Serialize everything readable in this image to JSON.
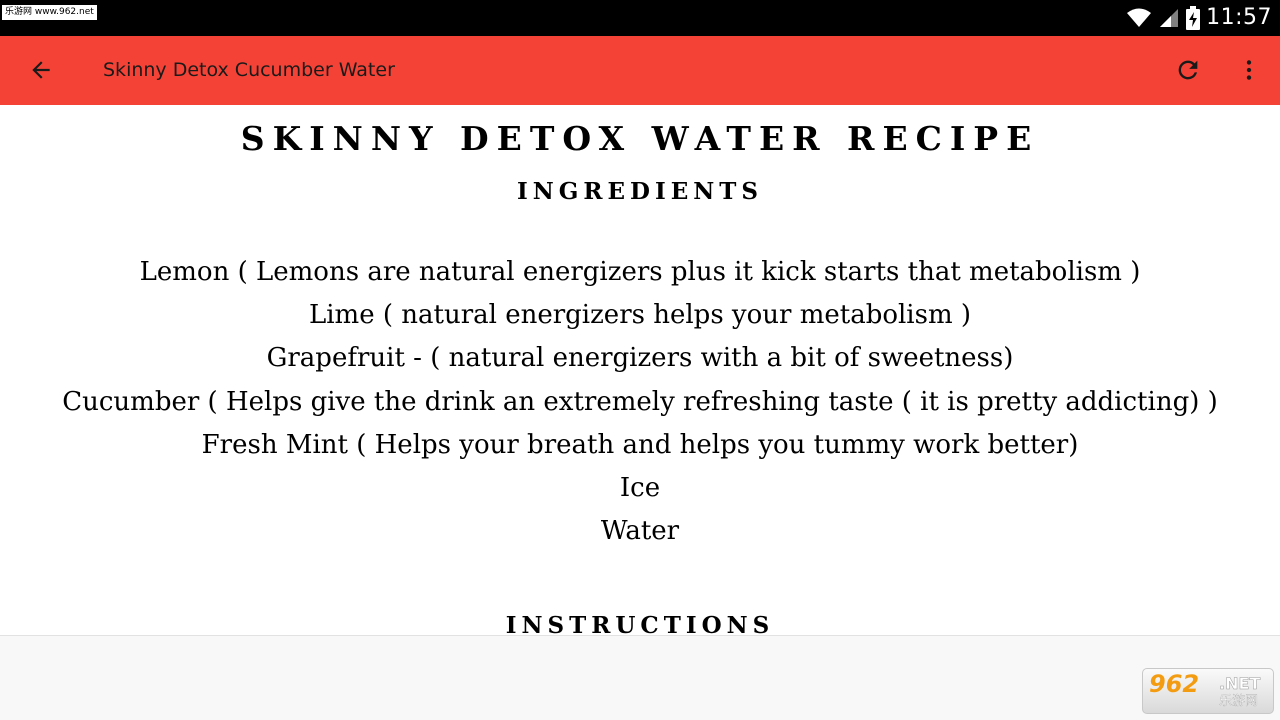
{
  "status_bar": {
    "watermark": "乐游网 www.962.net",
    "time": "11:57",
    "icons": [
      "wifi-icon",
      "cellular-signal-icon",
      "battery-charging-icon"
    ]
  },
  "app_bar": {
    "title": "Skinny Detox Cucumber Water",
    "background_color": "#f44336",
    "back_icon": "arrow-back-icon",
    "refresh_icon": "refresh-icon",
    "menu_icon": "more-vert-icon"
  },
  "recipe": {
    "title": "SKINNY DETOX WATER RECIPE",
    "ingredients_heading": "INGREDIENTS",
    "ingredients": [
      "Lemon ( Lemons are natural energizers plus it kick starts that metabolism )",
      "Lime ( natural energizers helps your metabolism )",
      "Grapefruit - ( natural energizers with a bit of sweetness)",
      "Cucumber ( Helps give the drink an extremely refreshing taste ( it is pretty addicting) )",
      "Fresh Mint ( Helps your breath and helps you tummy work better)",
      "Ice",
      "Water"
    ],
    "instructions_heading": "INSTRUCTIONS"
  },
  "watermark_bottom": {
    "brand": "962",
    "domain": ".NET",
    "chinese": "乐游网"
  }
}
